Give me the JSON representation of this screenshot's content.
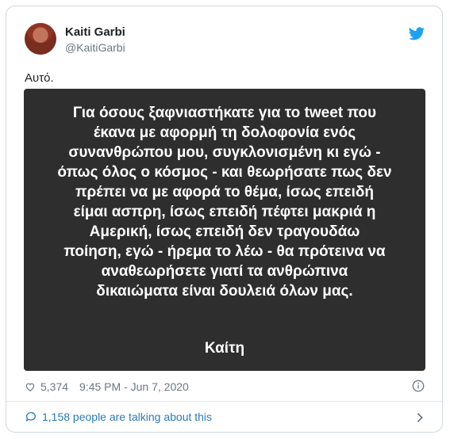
{
  "author": {
    "name": "Kaiti Garbi",
    "handle": "@KaitiGarbi"
  },
  "tweet": {
    "text": "Αυτό.",
    "image_quote": {
      "lines": [
        "Για όσους ξαφνιαστήκατε για το tweet που",
        "έκανα με αφορμή τη δολοφονία ενός",
        "συνανθρώπου μου, συγκλονισμένη κι εγώ -",
        "όπως όλος ο κόσμος - και θεωρήσατε πως δεν",
        "πρέπει να με αφορά το θέμα, ίσως επειδή",
        "είμαι ασπρη, ίσως επειδή πέφτει μακριά η",
        "Αμερική, ίσως επειδή  δεν τραγουδάω",
        "ποίηση, εγώ - ήρεμα το λέω - θα πρότεινα να",
        "αναθεωρήσετε γιατί τα ανθρώπινα",
        "δικαιώματα είναι δουλειά όλων μας."
      ],
      "signature": "Καίτη"
    }
  },
  "meta": {
    "likes": "5,374",
    "timestamp": "9:45 PM - Jun 7, 2020"
  },
  "footer": {
    "talking": "1,158 people are talking about this"
  },
  "icons": {
    "brand": "twitter-bird-icon",
    "like": "heart-icon",
    "info": "info-icon",
    "reply": "speech-bubble-icon",
    "more": "chevron-right-icon"
  },
  "colors": {
    "twitter_blue": "#1da1f2",
    "link_blue": "#2b7bb9",
    "muted": "#697882",
    "media_bg": "#2e2e2e"
  }
}
